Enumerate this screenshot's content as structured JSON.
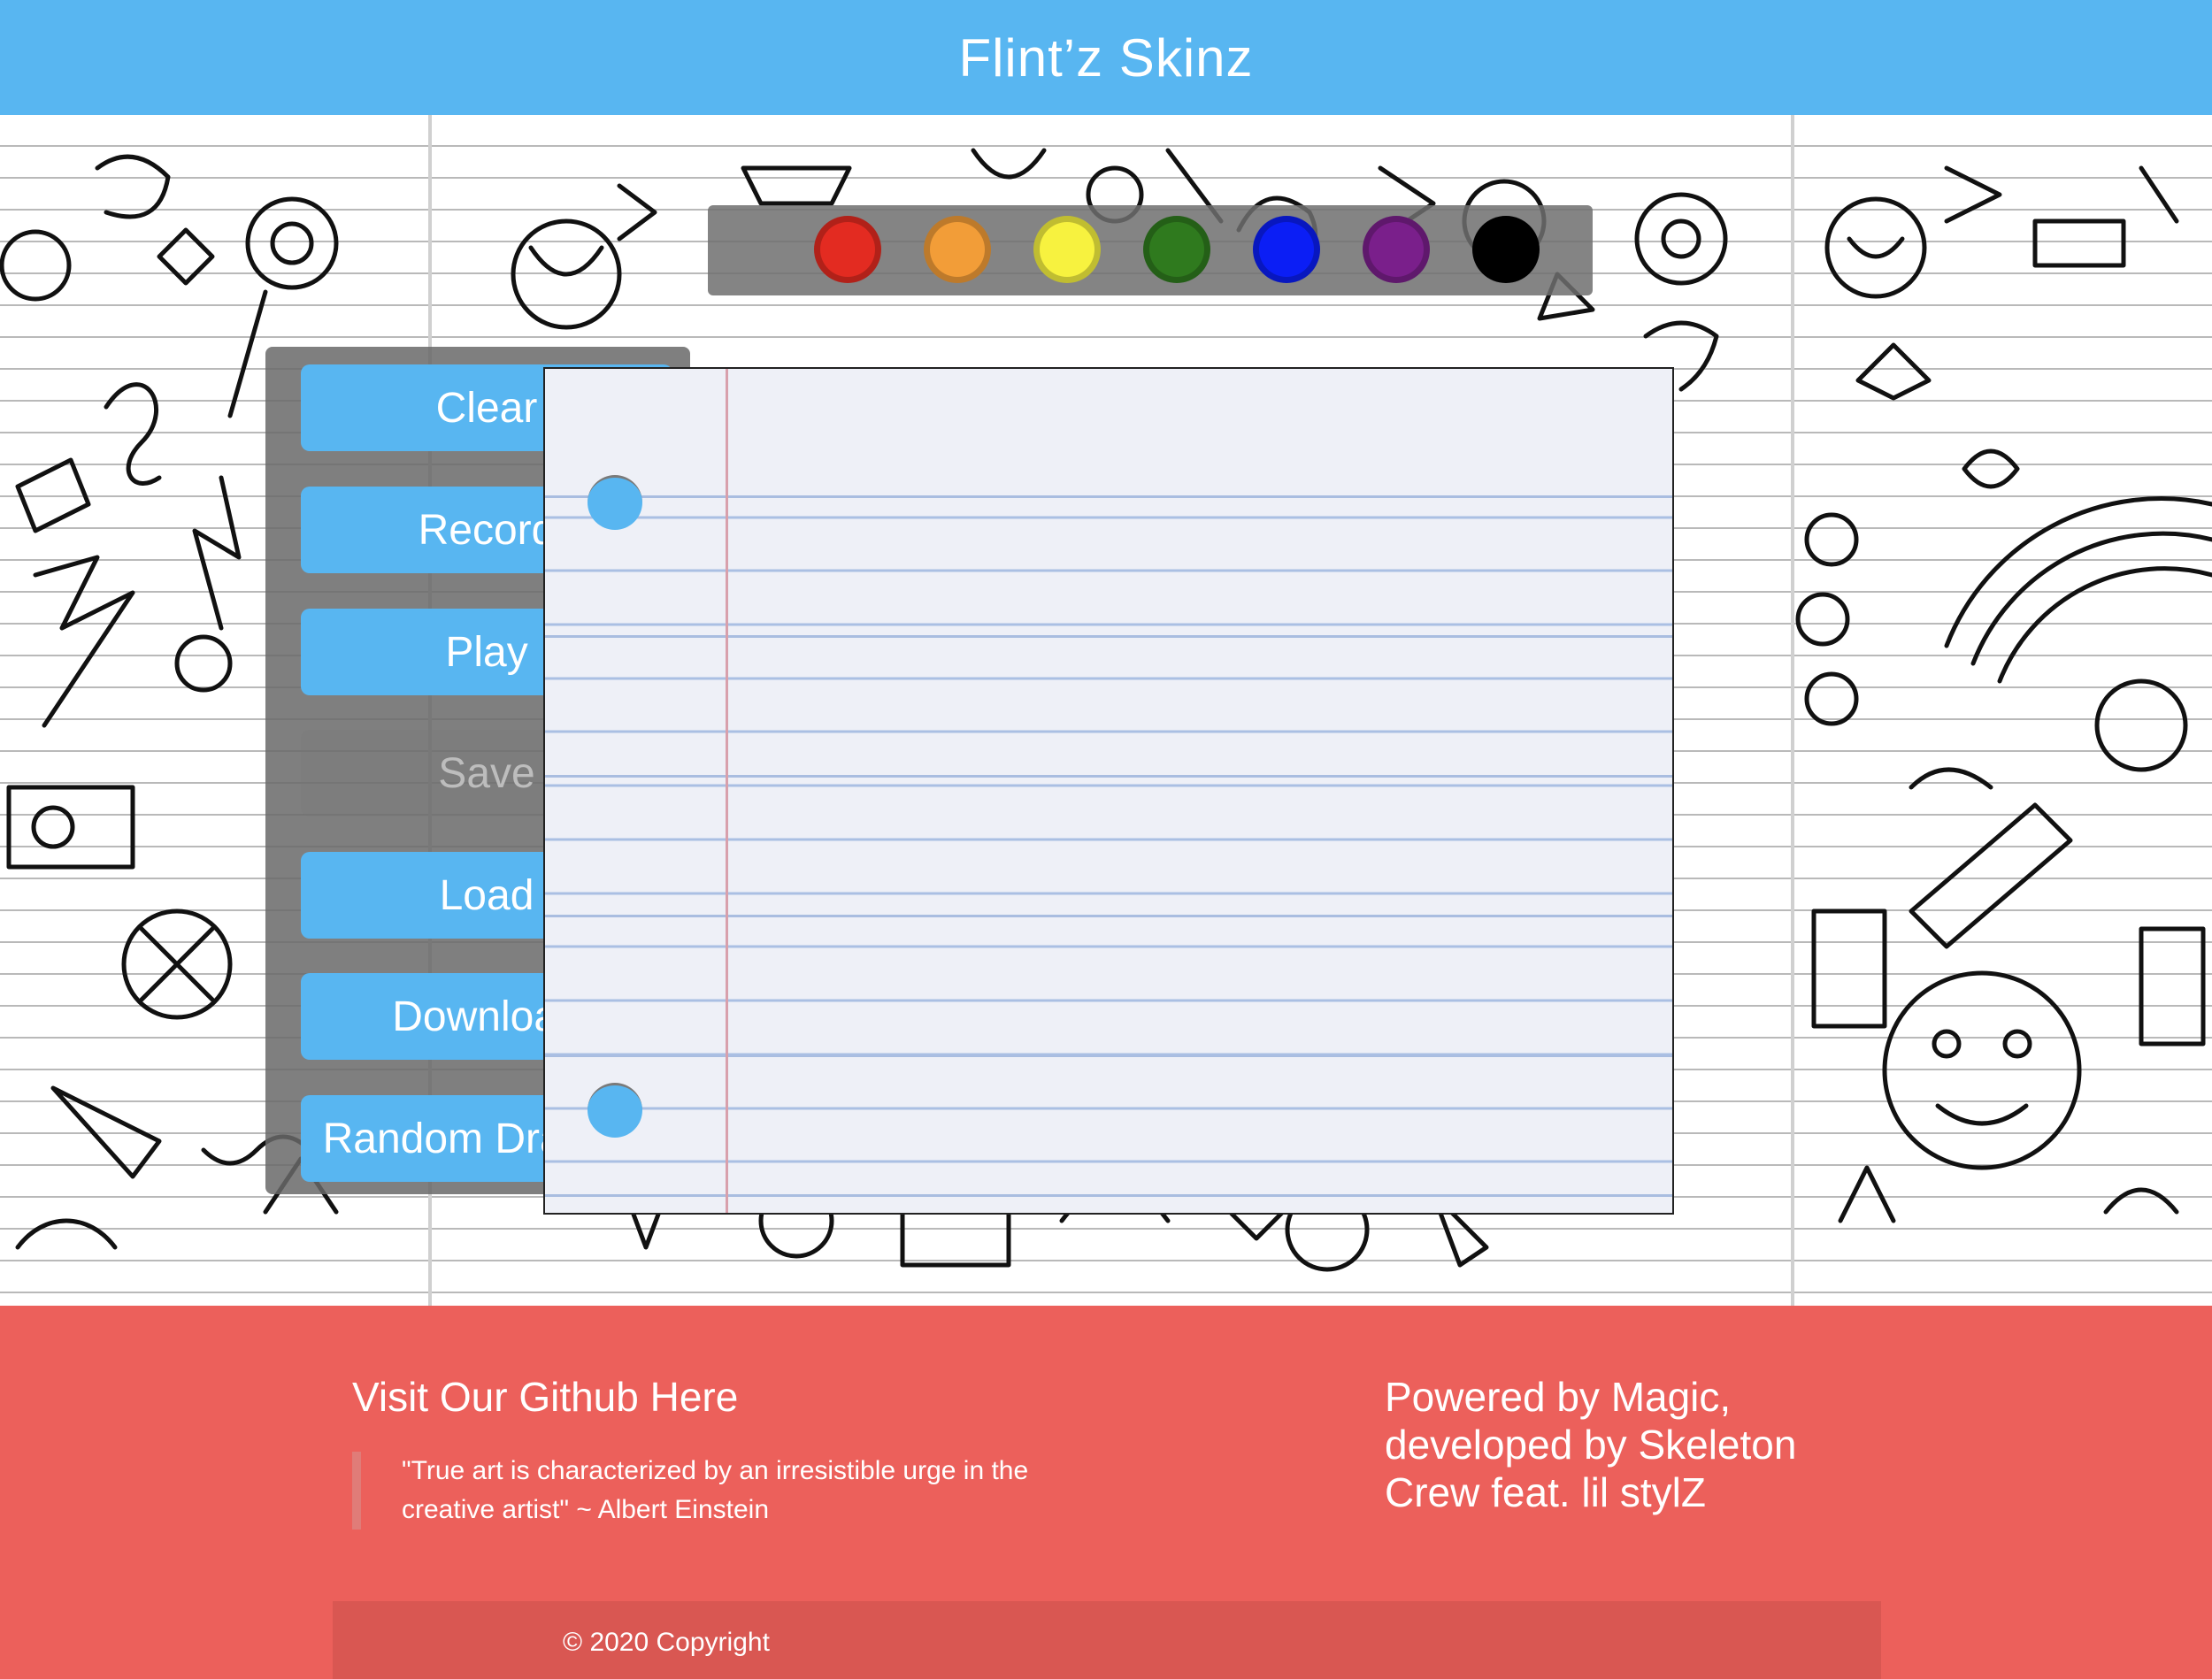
{
  "header": {
    "title": "Flint’z Skinz",
    "background": "#58b6f1"
  },
  "palette": {
    "colors": [
      {
        "name": "red",
        "hex": "#e32b21"
      },
      {
        "name": "orange",
        "hex": "#f29d38"
      },
      {
        "name": "yellow",
        "hex": "#f7f23f"
      },
      {
        "name": "green",
        "hex": "#2f7a1e"
      },
      {
        "name": "blue",
        "hex": "#0b1ef5"
      },
      {
        "name": "purple",
        "hex": "#7a1f8b"
      },
      {
        "name": "black",
        "hex": "#000000"
      }
    ]
  },
  "sidebar": {
    "buttons": [
      {
        "id": "clear",
        "label": "Clear",
        "enabled": true
      },
      {
        "id": "record",
        "label": "Record",
        "enabled": true
      },
      {
        "id": "play",
        "label": "Play",
        "enabled": true
      },
      {
        "id": "save",
        "label": "Save",
        "enabled": false
      },
      {
        "id": "load",
        "label": "Load",
        "enabled": true
      },
      {
        "id": "download",
        "label": "Download",
        "enabled": true
      },
      {
        "id": "random",
        "label": "Random Drawing",
        "enabled": true
      }
    ]
  },
  "footer": {
    "github_link": "Visit Our Github Here",
    "quote": "\"True art is characterized by an irresistible urge in the creative artist\" ~ Albert Einstein",
    "powered_by": "Powered by Magic, developed by Skeleton Crew feat. lil stylZ",
    "copyright": "© 2020 Copyright",
    "background": "#ec605b"
  }
}
